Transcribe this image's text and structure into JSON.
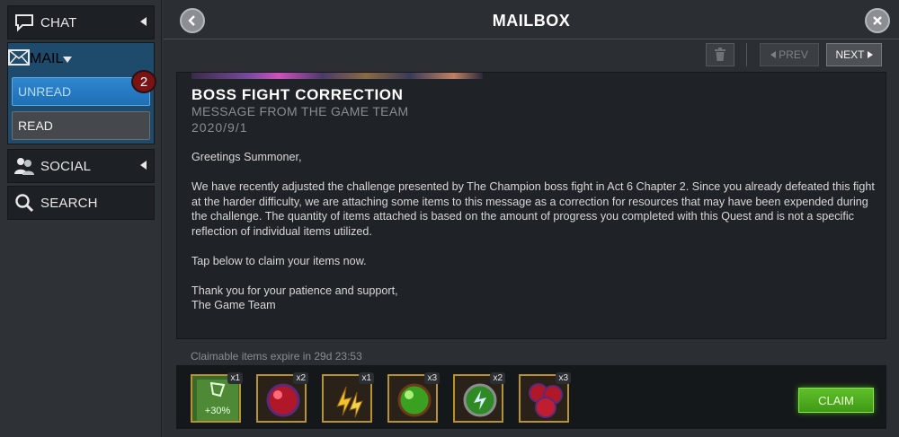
{
  "sidebar": {
    "chat_label": "CHAT",
    "mail_label": "MAIL",
    "unread_label": "UNREAD",
    "read_label": "READ",
    "unread_count": "2",
    "social_label": "SOCIAL",
    "search_label": "SEARCH"
  },
  "header": {
    "title": "MAILBOX"
  },
  "toolbar": {
    "prev_label": "PREV",
    "next_label": "NEXT"
  },
  "message": {
    "title": "BOSS FIGHT CORRECTION",
    "from": "MESSAGE FROM THE GAME TEAM",
    "date": "2020/9/1",
    "greeting": "Greetings Summoner,",
    "paragraph1": "We have recently adjusted the challenge presented by The Champion boss fight in Act 6 Chapter 2. Since you already defeated this fight at the harder difficulty, we are attaching some items to this message as a correction for resources that may have been expended during the challenge. The quantity of items attached is based on the amount of progress you completed with this Quest and is not a specific reflection of individual items utilized.",
    "paragraph2": "Tap below to claim your items now.",
    "signoff_line1": "Thank you for your patience and support,",
    "signoff_line2": "The Game Team"
  },
  "rewards": {
    "expire_text": "Claimable items expire in 29d 23:53",
    "claim_label": "CLAIM",
    "items": [
      {
        "icon": "boost-icon",
        "qty": "x1",
        "label": "+30%"
      },
      {
        "icon": "red-potion-icon",
        "qty": "x2"
      },
      {
        "icon": "lightning-shards-icon",
        "qty": "x1"
      },
      {
        "icon": "green-potion-icon",
        "qty": "x3"
      },
      {
        "icon": "green-revive-icon",
        "qty": "x2"
      },
      {
        "icon": "red-potion-cluster-icon",
        "qty": "x3"
      }
    ]
  },
  "colors": {
    "claim_green": "#4fae1e",
    "unread_blue": "#2a7fc8",
    "badge_red": "#7a1414",
    "item_border_gold": "#b8922e"
  }
}
